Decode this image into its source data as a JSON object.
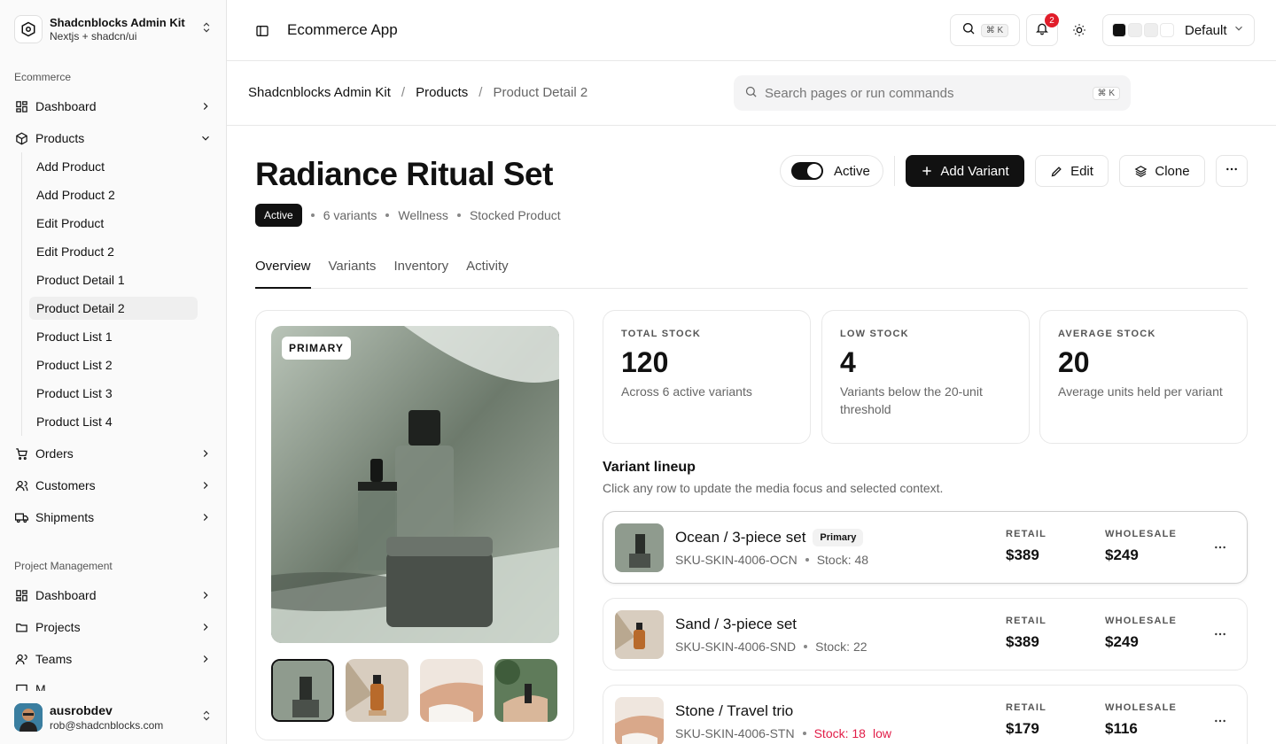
{
  "sidebar": {
    "brand_title": "Shadcnblocks Admin Kit",
    "brand_sub": "Nextjs + shadcn/ui",
    "section_ecommerce": "Ecommerce",
    "section_pm": "Project Management",
    "ecom_items": [
      "Dashboard",
      "Products",
      "Orders",
      "Customers",
      "Shipments"
    ],
    "product_sub": [
      "Add Product",
      "Add Product 2",
      "Edit Product",
      "Edit Product 2",
      "Product Detail 1",
      "Product Detail 2",
      "Product List 1",
      "Product List 2",
      "Product List 3",
      "Product List 4"
    ],
    "pm_items": [
      "Dashboard",
      "Projects",
      "Teams",
      "M..."
    ],
    "user_name": "ausrobdev",
    "user_email": "rob@shadcnblocks.com"
  },
  "topbar": {
    "title": "Ecommerce App",
    "search_kbd": "⌘ K",
    "notif_count": "2",
    "theme_label": "Default",
    "swatches": [
      "#111111",
      "#eeeeee",
      "#eeeeee",
      "#ffffff"
    ]
  },
  "breadcrumb": {
    "items": [
      "Shadcnblocks Admin Kit",
      "Products",
      "Product Detail 2"
    ],
    "cmd_placeholder": "Search pages or run commands",
    "cmd_kbd": "⌘ K"
  },
  "product": {
    "name": "Radiance Ritual Set",
    "status": "Active",
    "variants": "6 variants",
    "category": "Wellness",
    "type": "Stocked Product",
    "toggle_label": "Active",
    "add_variant": "Add Variant",
    "edit": "Edit",
    "clone": "Clone"
  },
  "tabs": [
    "Overview",
    "Variants",
    "Inventory",
    "Activity"
  ],
  "gallery": {
    "primary_tag": "PRIMARY"
  },
  "stats": [
    {
      "label": "TOTAL STOCK",
      "value": "120",
      "sub": "Across 6 active variants"
    },
    {
      "label": "LOW STOCK",
      "value": "4",
      "sub": "Variants below the 20-unit threshold"
    },
    {
      "label": "AVERAGE STOCK",
      "value": "20",
      "sub": "Average units held per variant"
    }
  ],
  "lineup": {
    "title": "Variant lineup",
    "subtitle": "Click any row to update the media focus and selected context.",
    "retail_label": "RETAIL",
    "wholesale_label": "WHOLESALE",
    "rows": [
      {
        "name": "Ocean / 3-piece set",
        "tag": "Primary",
        "sku": "SKU-SKIN-4006-OCN",
        "stock": "Stock: 48",
        "low": "",
        "retail": "$389",
        "wholesale": "$249"
      },
      {
        "name": "Sand / 3-piece set",
        "tag": "",
        "sku": "SKU-SKIN-4006-SND",
        "stock": "Stock: 22",
        "low": "",
        "retail": "$389",
        "wholesale": "$249"
      },
      {
        "name": "Stone / Travel trio",
        "tag": "",
        "sku": "SKU-SKIN-4006-STN",
        "stock": "Stock: 18",
        "low": "low",
        "retail": "$179",
        "wholesale": "$116"
      }
    ]
  }
}
